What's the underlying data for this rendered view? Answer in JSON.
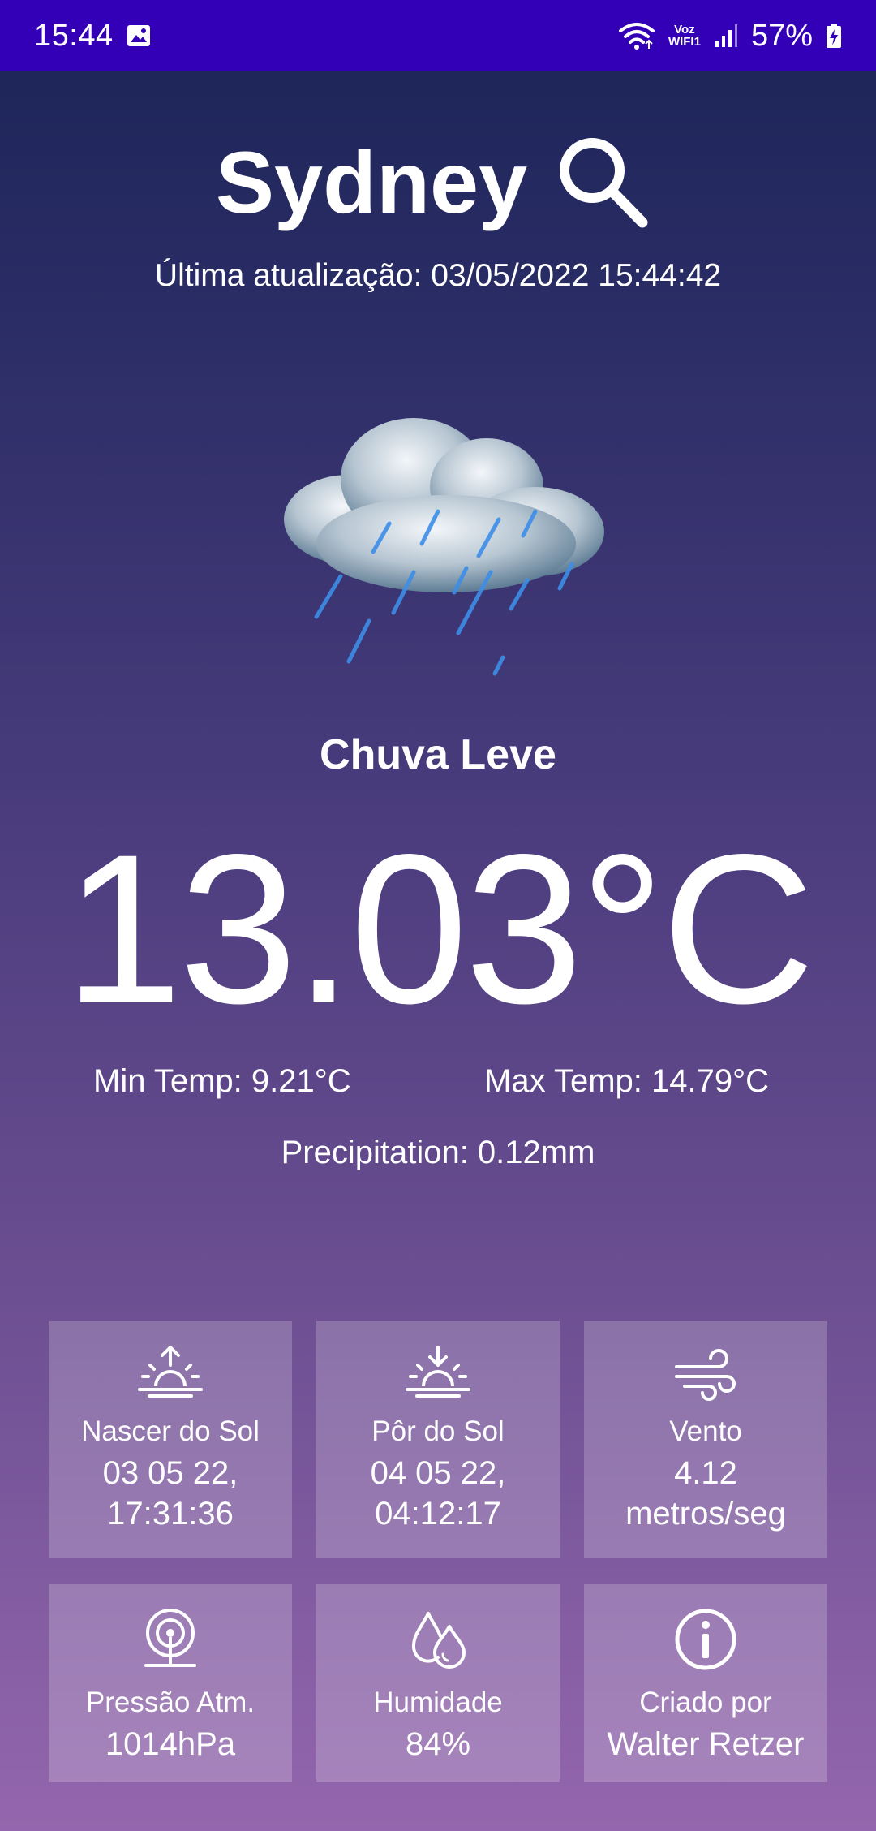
{
  "status_bar": {
    "time": "15:44",
    "gallery_icon": "image-icon",
    "wifi_icon": "wifi-icon",
    "voz_top": "Voz",
    "voz_bottom": "WIFI1",
    "signal_icon": "signal-icon",
    "battery_text": "57%",
    "battery_icon": "battery-charging-icon",
    "bar_color": "#3300b7"
  },
  "header": {
    "city": "Sydney",
    "search_icon": "search-icon",
    "updated": "Última atualização: 03/05/2022 15:44:42"
  },
  "weather": {
    "icon": "rain-cloud-icon",
    "condition": "Chuva Leve",
    "temperature": "13.03°C",
    "min_temp": "Min Temp: 9.21°C",
    "max_temp": "Max Temp: 14.79°C",
    "precipitation": "Precipitation: 0.12mm"
  },
  "cards": {
    "sunrise": {
      "icon": "sunrise-icon",
      "label": "Nascer do Sol",
      "value": "03 05 22,",
      "value2": "17:31:36"
    },
    "sunset": {
      "icon": "sunset-icon",
      "label": "Pôr do Sol",
      "value": "04 05 22,",
      "value2": "04:12:17"
    },
    "wind": {
      "icon": "wind-icon",
      "label": "Vento",
      "value": "4.12",
      "value2": "metros/seg"
    },
    "pressure": {
      "icon": "pressure-icon",
      "label": "Pressão Atm.",
      "value": "1014hPa"
    },
    "humidity": {
      "icon": "humidity-icon",
      "label": "Humidade",
      "value": "84%"
    },
    "info": {
      "icon": "info-icon",
      "label": "Criado por",
      "value": "Walter Retzer"
    }
  }
}
